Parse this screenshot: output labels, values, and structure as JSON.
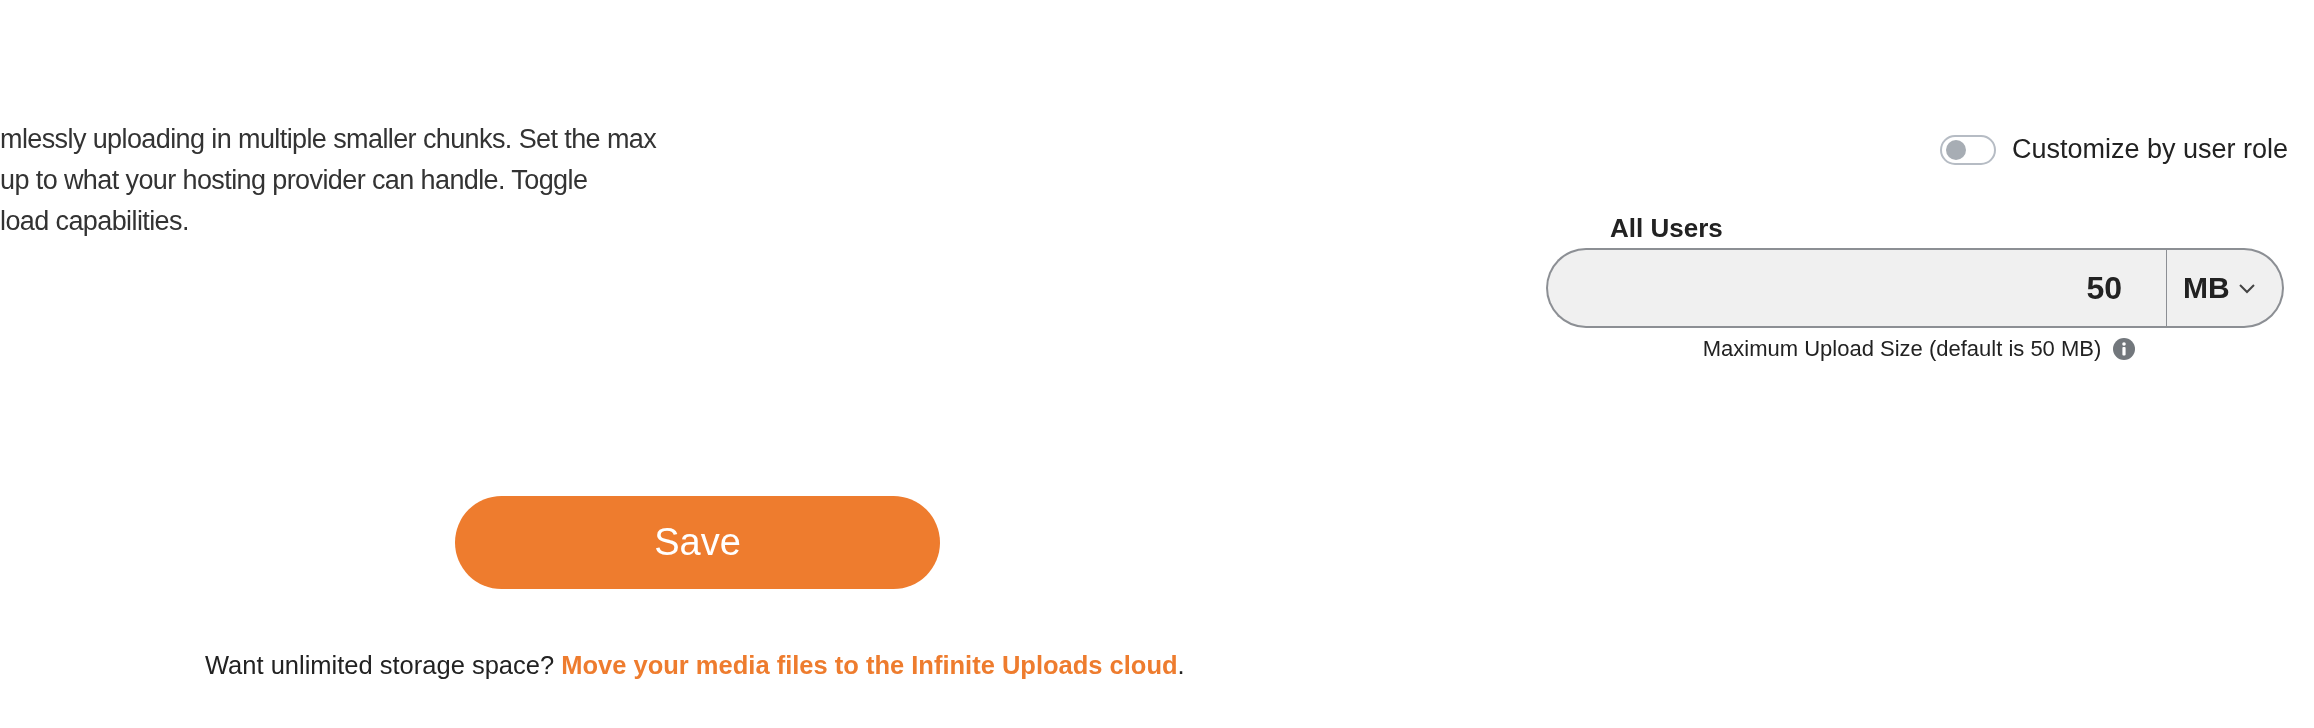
{
  "description": {
    "lines": [
      "mlessly uploading in multiple smaller chunks. Set the max",
      "up to what your hosting provider can handle. Toggle",
      "load capabilities."
    ]
  },
  "role_toggle": {
    "label": "Customize by user role",
    "on": false
  },
  "upload_limit": {
    "label": "All Users",
    "value": "50",
    "unit": "MB",
    "help": "Maximum Upload Size (default is 50 MB)"
  },
  "save_button": {
    "label": "Save"
  },
  "footer": {
    "text": "Want unlimited storage space?",
    "link": "Move your media files to the Infinite Uploads cloud",
    "end": "."
  }
}
